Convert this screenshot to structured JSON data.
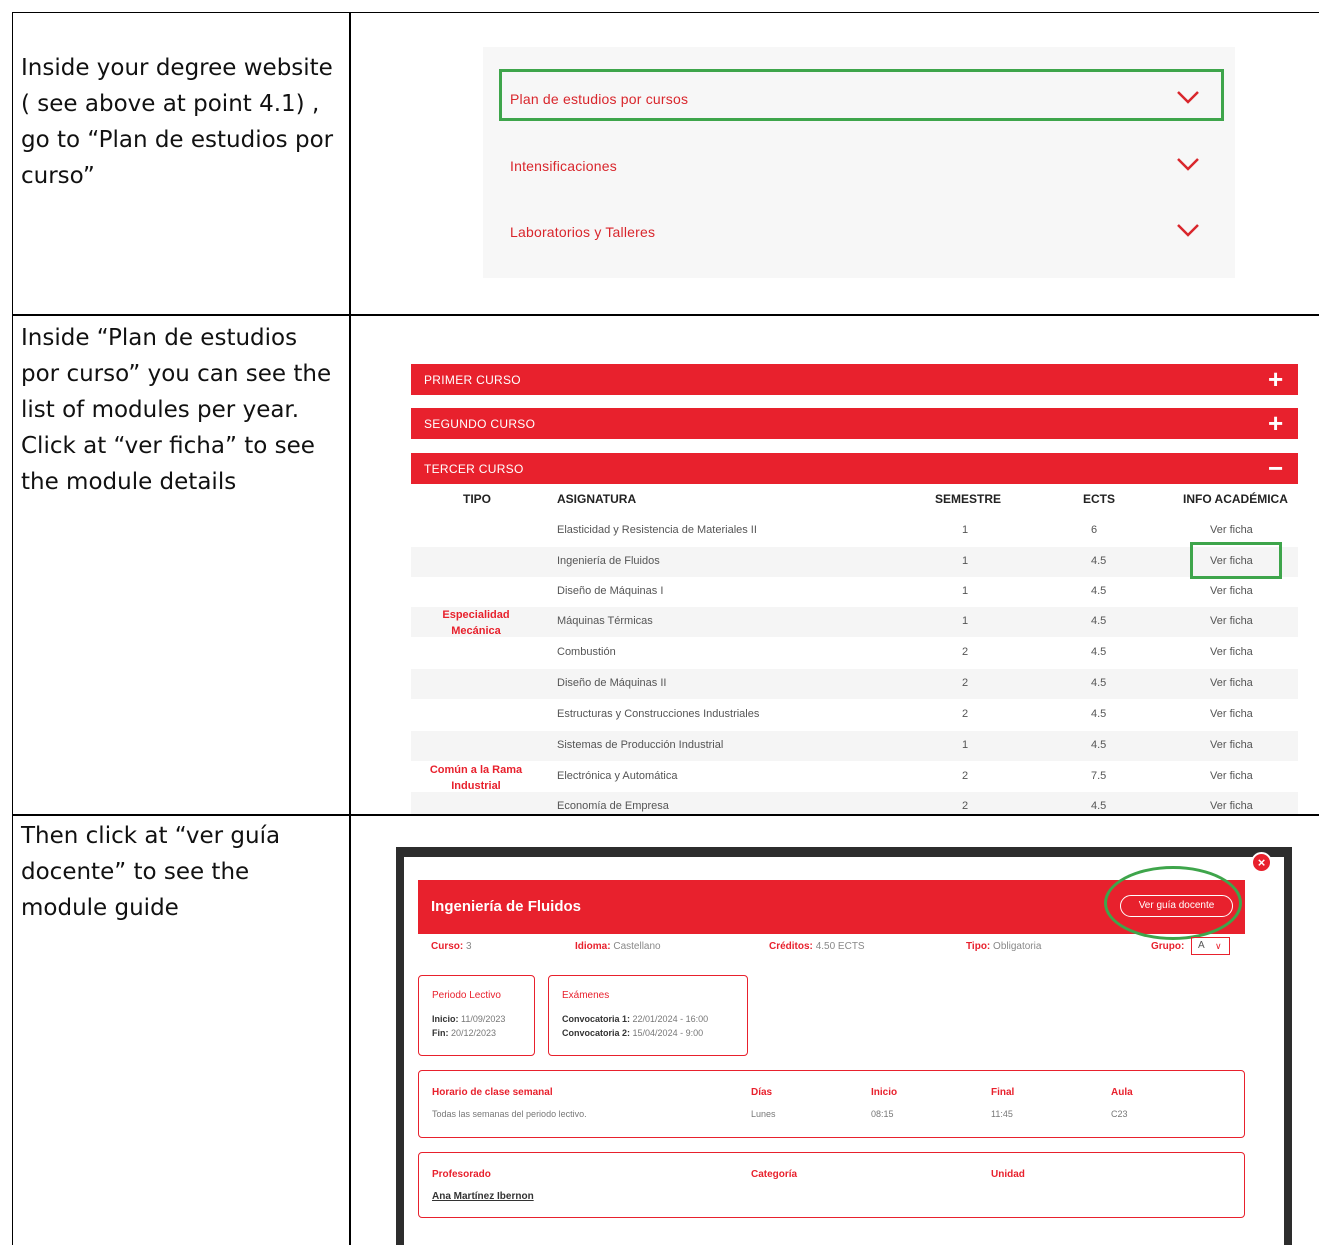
{
  "instructions": {
    "step1": "Inside your degree website ( see above at point 4.1) , go to “Plan de estudios por curso”",
    "step2": "Inside “Plan de estudios por curso” you can see the list of modules per year. Click at “ver ficha” to see the module details",
    "step3": "Then click at  “ver guía docente” to see the module guide"
  },
  "accordion": {
    "items": [
      {
        "label": "Plan de estudios por cursos"
      },
      {
        "label": "Intensificaciones"
      },
      {
        "label": "Laboratorios y Talleres"
      }
    ]
  },
  "courses": {
    "bars": [
      {
        "label": "PRIMER CURSO",
        "sign": "+"
      },
      {
        "label": "SEGUNDO CURSO",
        "sign": "+"
      },
      {
        "label": "TERCER CURSO",
        "sign": "−"
      }
    ],
    "headers": {
      "tipo": "TIPO",
      "asignatura": "ASIGNATURA",
      "semestre": "SEMESTRE",
      "ects": "ECTS",
      "info": "INFO ACADÉMICA"
    },
    "groups": [
      {
        "tipo": "Especialidad\nMecánica"
      },
      {
        "tipo": "Común a la Rama\nIndustrial"
      }
    ],
    "rows": [
      {
        "asignatura": "Elasticidad y Resistencia de Materiales II",
        "semestre": "1",
        "ects": "6",
        "info": "Ver ficha"
      },
      {
        "asignatura": "Ingeniería de Fluidos",
        "semestre": "1",
        "ects": "4.5",
        "info": "Ver ficha"
      },
      {
        "asignatura": "Diseño de Máquinas I",
        "semestre": "1",
        "ects": "4.5",
        "info": "Ver ficha"
      },
      {
        "asignatura": "Máquinas Térmicas",
        "semestre": "1",
        "ects": "4.5",
        "info": "Ver ficha"
      },
      {
        "asignatura": "Combustión",
        "semestre": "2",
        "ects": "4.5",
        "info": "Ver ficha"
      },
      {
        "asignatura": "Diseño de Máquinas II",
        "semestre": "2",
        "ects": "4.5",
        "info": "Ver ficha"
      },
      {
        "asignatura": "Estructuras y Construcciones Industriales",
        "semestre": "2",
        "ects": "4.5",
        "info": "Ver ficha"
      },
      {
        "asignatura": "Sistemas de Producción Industrial",
        "semestre": "1",
        "ects": "4.5",
        "info": "Ver ficha"
      },
      {
        "asignatura": "Electrónica y Automática",
        "semestre": "2",
        "ects": "7.5",
        "info": "Ver ficha"
      },
      {
        "asignatura": "Economía de Empresa",
        "semestre": "2",
        "ects": "4.5",
        "info": "Ver ficha"
      }
    ]
  },
  "modal": {
    "title": "Ingeniería de Fluidos",
    "guia_button": "Ver guía docente",
    "close": "×",
    "meta": {
      "curso_label": "Curso:",
      "curso": "3",
      "idioma_label": "Idioma:",
      "idioma": "Castellano",
      "creditos_label": "Créditos:",
      "creditos": "4.50 ECTS",
      "tipo_label": "Tipo:",
      "tipo": "Obligatoria",
      "grupo_label": "Grupo:",
      "grupo": "A"
    },
    "periodo": {
      "title": "Periodo Lectivo",
      "inicio_label": "Inicio:",
      "inicio": "11/09/2023",
      "fin_label": "Fin:",
      "fin": "20/12/2023"
    },
    "examenes": {
      "title": "Exámenes",
      "c1_label": "Convocatoria 1:",
      "c1": "22/01/2024 - 16:00",
      "c2_label": "Convocatoria 2:",
      "c2": "15/04/2024 - 9:00"
    },
    "horario": {
      "title": "Horario de clase semanal",
      "dias_label": "Días",
      "inicio_label": "Inicio",
      "final_label": "Final",
      "aula_label": "Aula",
      "desc": "Todas las semanas del periodo lectivo.",
      "dias": "Lunes",
      "inicio": "08:15",
      "final": "11:45",
      "aula": "C23"
    },
    "profesorado": {
      "title": "Profesorado",
      "categoria_label": "Categoría",
      "unidad_label": "Unidad",
      "nombre": "Ana Martínez Ibernon"
    }
  },
  "colors": {
    "accent": "#e8212d",
    "highlight": "#3ea54b"
  }
}
